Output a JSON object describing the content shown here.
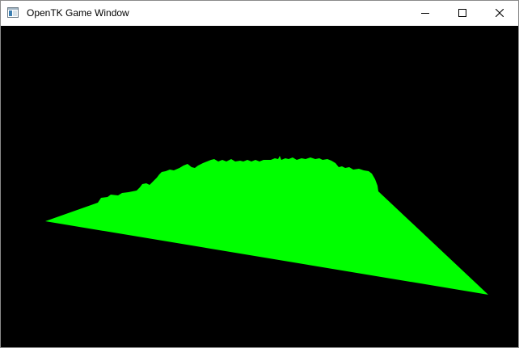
{
  "window": {
    "title": "OpenTK Game Window",
    "icon": "app-window-icon",
    "controls": {
      "minimize_icon": "minimize-icon",
      "maximize_icon": "maximize-icon",
      "close_icon": "close-icon"
    }
  },
  "scene": {
    "background_color": "#000000",
    "terrain_color": "#00ff00",
    "content": "3D terrain mesh rendered in solid green"
  }
}
